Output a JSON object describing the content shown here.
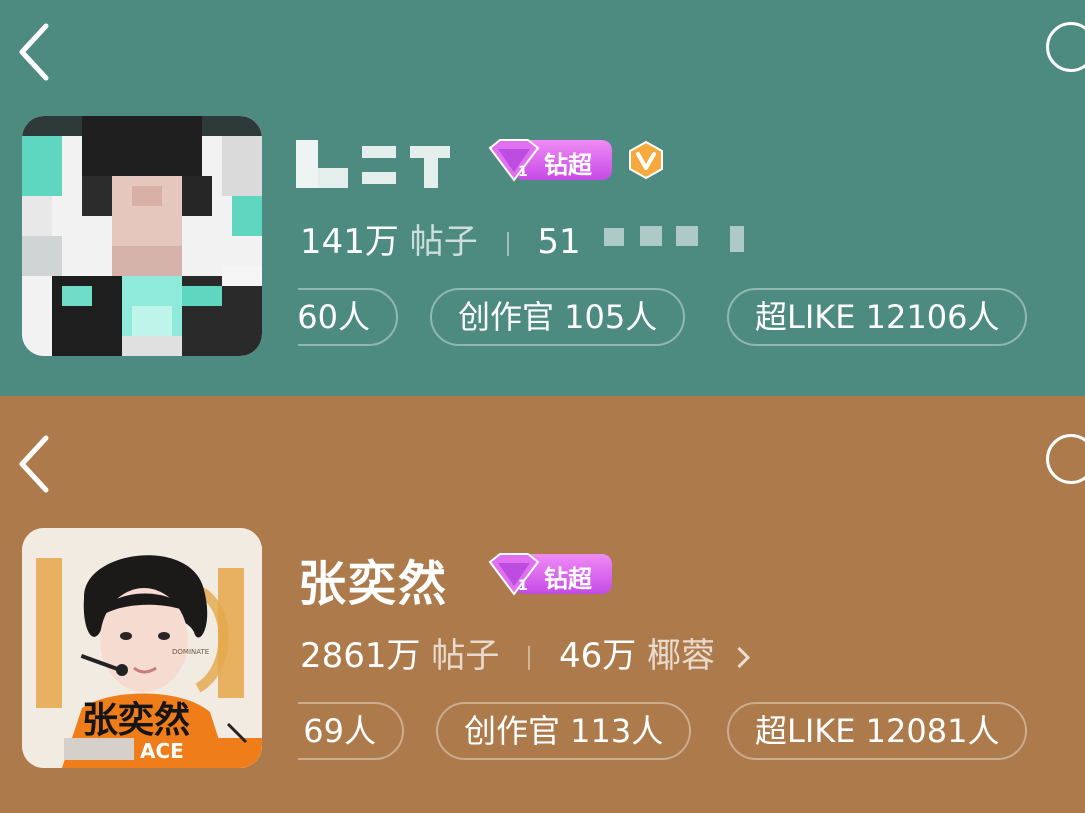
{
  "colors": {
    "top_bg": "#4d8b80",
    "bottom_bg": "#ad7a4c",
    "badge_purple": "#c64ae6",
    "verified_orange": "#f7a93c"
  },
  "top_card": {
    "name": "",
    "badge_label": "钻超",
    "verified_icon": "v-badge-icon",
    "stats": {
      "posts_count": "141万",
      "posts_unit": "帖子",
      "fans_count": "51"
    },
    "pills": [
      "60人",
      "创作官 105人",
      "超LIKE 12106人"
    ]
  },
  "bottom_card": {
    "name": "张奕然",
    "badge_label": "钻超",
    "stats": {
      "posts_count": "2861万",
      "posts_unit": "帖子",
      "fans_count": "46万",
      "fans_unit": "椰蓉"
    },
    "pills": [
      "69人",
      "创作官 113人",
      "超LIKE 12081人"
    ],
    "avatar": {
      "caption_name": "张奕然",
      "caption_tag": "ACE",
      "caption_sub": "DOMINATE"
    }
  }
}
